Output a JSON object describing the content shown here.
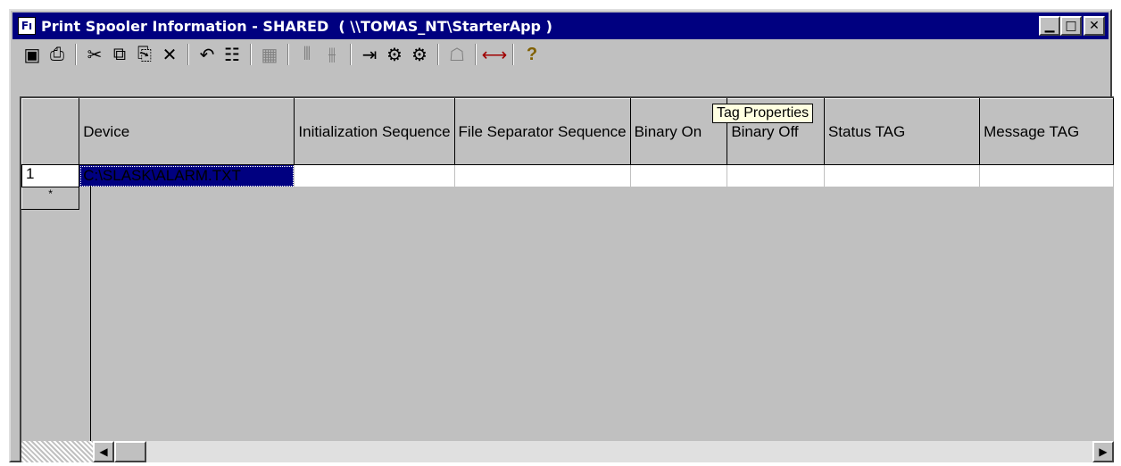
{
  "window": {
    "title": "Print Spooler Information - SHARED  ( \\\\TOMAS_NT\\StarterApp )",
    "app_icon_text": "Fı",
    "minimize": "▁",
    "maximize": "□",
    "close": "✕"
  },
  "toolbar": {
    "save": "▣",
    "print": "⎙",
    "cut": "✂",
    "copy": "⧉",
    "paste": "⎘",
    "delete": "✕",
    "undo": "↶",
    "find": "☷",
    "grid": "▦",
    "insert_col": "⫴",
    "delete_col": "⫵",
    "tag_browse": "⇥",
    "check": "⚙",
    "check2": "⚙",
    "properties": "☖",
    "tag_properties": "⟷",
    "help": "?"
  },
  "tooltip": "Tag Properties",
  "columns": [
    "Device",
    "Initialization Sequence",
    "File Separator Sequence",
    "Binary On",
    "Binary Off",
    "Status TAG",
    "Message TAG"
  ],
  "rows": [
    {
      "num": "1",
      "cells": [
        "C:\\SLASK\\ALARM.TXT",
        "",
        "",
        "",
        "",
        "",
        ""
      ]
    }
  ],
  "new_row_marker": "*",
  "scroll": {
    "left": "◀",
    "right": "▶"
  }
}
